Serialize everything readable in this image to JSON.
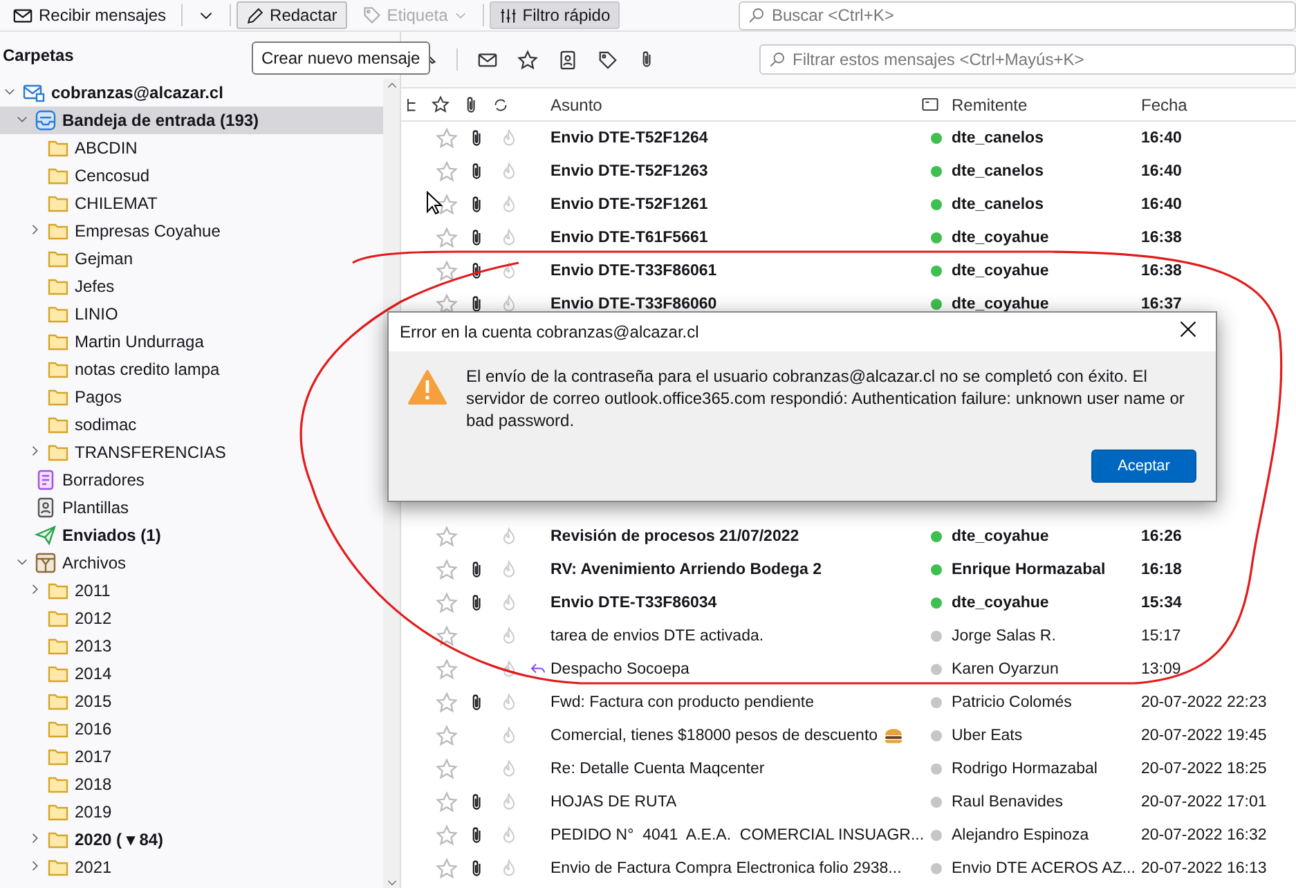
{
  "toolbar": {
    "items": [
      {
        "kind": "get",
        "label": "Recibir mensajes",
        "disabled": false,
        "pressed": false
      },
      {
        "kind": "menu",
        "disabled": false,
        "pressed": false
      },
      {
        "kind": "compose",
        "label": "Redactar",
        "disabled": false,
        "pressed": false
      },
      {
        "kind": "tag",
        "label": "Etiqueta",
        "disabled": true,
        "pressed": false
      },
      {
        "kind": "filter",
        "label": "Filtro rápido",
        "disabled": false,
        "pressed": true
      }
    ],
    "search": {
      "placeholder": "Buscar <Ctrl+K>"
    }
  },
  "tooltip": {
    "text": "Crear nuevo mensaje"
  },
  "folder_pane": {
    "title": "Carpetas",
    "folders": [
      {
        "label": "cobranzas@alcazar.cl",
        "kind": "account",
        "selected": false,
        "has_unread": true,
        "expanded": true,
        "children": [
          {
            "label": "Bandeja de entrada (193)",
            "kind": "inbox",
            "selected": true,
            "has_unread": true,
            "expanded": true,
            "children": [
              {
                "label": "ABCDIN",
                "kind": "folder",
                "selected": false,
                "has_unread": false
              },
              {
                "label": "Cencosud",
                "kind": "folder",
                "selected": false,
                "has_unread": false
              },
              {
                "label": "CHILEMAT",
                "kind": "folder",
                "selected": false,
                "has_unread": false
              },
              {
                "label": "Empresas Coyahue",
                "kind": "folder",
                "selected": false,
                "has_unread": false,
                "expanded": false
              },
              {
                "label": "Gejman",
                "kind": "folder",
                "selected": false,
                "has_unread": false
              },
              {
                "label": "Jefes",
                "kind": "folder",
                "selected": false,
                "has_unread": false
              },
              {
                "label": "LINIO",
                "kind": "folder",
                "selected": false,
                "has_unread": false
              },
              {
                "label": "Martin Undurraga",
                "kind": "folder",
                "selected": false,
                "has_unread": false
              },
              {
                "label": "notas credito lampa",
                "kind": "folder",
                "selected": false,
                "has_unread": false
              },
              {
                "label": "Pagos",
                "kind": "folder",
                "selected": false,
                "has_unread": false
              },
              {
                "label": "sodimac",
                "kind": "folder",
                "selected": false,
                "has_unread": false
              },
              {
                "label": "TRANSFERENCIAS",
                "kind": "folder",
                "selected": false,
                "has_unread": false,
                "expanded": false
              }
            ]
          },
          {
            "label": "Borradores",
            "kind": "drafts",
            "selected": false,
            "has_unread": false
          },
          {
            "label": "Plantillas",
            "kind": "templates",
            "selected": false,
            "has_unread": false
          },
          {
            "label": "Enviados (1)",
            "kind": "sent",
            "selected": false,
            "has_unread": true
          },
          {
            "label": "Archivos",
            "kind": "archive",
            "selected": false,
            "has_unread": false,
            "expanded": true,
            "children": [
              {
                "label": "2011",
                "kind": "folder",
                "selected": false,
                "has_unread": false,
                "expanded": false
              },
              {
                "label": "2012",
                "kind": "folder",
                "selected": false,
                "has_unread": false
              },
              {
                "label": "2013",
                "kind": "folder",
                "selected": false,
                "has_unread": false
              },
              {
                "label": "2014",
                "kind": "folder",
                "selected": false,
                "has_unread": false
              },
              {
                "label": "2015",
                "kind": "folder",
                "selected": false,
                "has_unread": false
              },
              {
                "label": "2016",
                "kind": "folder",
                "selected": false,
                "has_unread": false
              },
              {
                "label": "2017",
                "kind": "folder",
                "selected": false,
                "has_unread": false
              },
              {
                "label": "2018",
                "kind": "folder",
                "selected": false,
                "has_unread": false
              },
              {
                "label": "2019",
                "kind": "folder",
                "selected": false,
                "has_unread": false
              },
              {
                "label": "2020 ( ▾ 84)",
                "kind": "folder",
                "selected": false,
                "has_unread": true,
                "expanded": false
              },
              {
                "label": "2021",
                "kind": "folder",
                "selected": false,
                "has_unread": false,
                "expanded": false
              }
            ]
          }
        ]
      }
    ]
  },
  "message_list": {
    "filter": {
      "placeholder": "Filtrar estos mensajes <Ctrl+Mayús+K>"
    },
    "columns": [
      "Asunto",
      "Remitente",
      "Fecha"
    ],
    "rows": [
      {
        "subject": "Envio DTE-T52F1264",
        "sender": "dte_canelos",
        "date": "16:40",
        "unread": true,
        "attachment": true,
        "starred": false,
        "replied": false,
        "emoji": false
      },
      {
        "subject": "Envio DTE-T52F1263",
        "sender": "dte_canelos",
        "date": "16:40",
        "unread": true,
        "attachment": true,
        "starred": false,
        "replied": false,
        "emoji": false
      },
      {
        "subject": "Envio DTE-T52F1261",
        "sender": "dte_canelos",
        "date": "16:40",
        "unread": true,
        "attachment": true,
        "starred": false,
        "replied": false,
        "emoji": false
      },
      {
        "subject": "Envio DTE-T61F5661",
        "sender": "dte_coyahue",
        "date": "16:38",
        "unread": true,
        "attachment": true,
        "starred": false,
        "replied": false,
        "emoji": false
      },
      {
        "subject": "Envio DTE-T33F86061",
        "sender": "dte_coyahue",
        "date": "16:38",
        "unread": true,
        "attachment": true,
        "starred": false,
        "replied": false,
        "emoji": false
      },
      {
        "subject": "Envio DTE-T33F86060",
        "sender": "dte_coyahue",
        "date": "16:37",
        "unread": true,
        "attachment": true,
        "starred": false,
        "replied": false,
        "emoji": false
      }
    ],
    "rows_below_dialog": [
      {
        "subject": "Revisión de procesos 21/07/2022",
        "sender": "dte_coyahue",
        "date": "16:26",
        "unread": true,
        "attachment": false,
        "starred": false,
        "replied": false,
        "emoji": false
      },
      {
        "subject": "RV: Avenimiento Arriendo Bodega 2",
        "sender": "Enrique Hormazabal",
        "date": "16:18",
        "unread": true,
        "attachment": true,
        "starred": false,
        "replied": false,
        "emoji": false
      },
      {
        "subject": "Envio DTE-T33F86034",
        "sender": "dte_coyahue",
        "date": "15:34",
        "unread": true,
        "attachment": true,
        "starred": false,
        "replied": false,
        "emoji": false
      },
      {
        "subject": "tarea de envios DTE activada.",
        "sender": "Jorge Salas R.",
        "date": "15:17",
        "unread": false,
        "attachment": false,
        "starred": false,
        "replied": false,
        "emoji": false
      },
      {
        "subject": "Despacho Socoepa",
        "sender": "Karen Oyarzun",
        "date": "13:09",
        "unread": false,
        "attachment": false,
        "starred": false,
        "replied": true,
        "emoji": false
      },
      {
        "subject": "Fwd: Factura con producto pendiente",
        "sender": "Patricio Colomés",
        "date": "20-07-2022 22:23",
        "unread": false,
        "attachment": true,
        "starred": false,
        "replied": false,
        "emoji": false
      },
      {
        "subject": "Comercial, tienes $18000 pesos de descuento",
        "sender": "Uber Eats",
        "date": "20-07-2022 19:45",
        "unread": false,
        "attachment": false,
        "starred": false,
        "replied": false,
        "emoji": true
      },
      {
        "subject": "Re: Detalle Cuenta Maqcenter",
        "sender": "Rodrigo Hormazabal",
        "date": "20-07-2022 18:25",
        "unread": false,
        "attachment": false,
        "starred": false,
        "replied": false,
        "emoji": false
      },
      {
        "subject": "HOJAS DE RUTA",
        "sender": "Raul Benavides",
        "date": "20-07-2022 17:01",
        "unread": false,
        "attachment": true,
        "starred": false,
        "replied": false,
        "emoji": false
      },
      {
        "subject": "PEDIDO N°  4041  A.E.A.  COMERCIAL INSUAGR...",
        "sender": "Alejandro Espinoza",
        "date": "20-07-2022 16:32",
        "unread": false,
        "attachment": true,
        "starred": false,
        "replied": false,
        "emoji": false
      },
      {
        "subject": "Envio de Factura Compra Electronica folio 2938...",
        "sender": "Envio DTE ACEROS AZ...",
        "date": "20-07-2022 16:13",
        "unread": false,
        "attachment": true,
        "starred": false,
        "replied": false,
        "emoji": false
      }
    ]
  },
  "dialog": {
    "title": "Error en la cuenta cobranzas@alcazar.cl",
    "message": "El envío de la contraseña para el usuario cobranzas@alcazar.cl no se completó con éxito. El servidor de correo outlook.office365.com respondió: Authentication failure: unknown user name or bad password.",
    "button": "Aceptar"
  }
}
